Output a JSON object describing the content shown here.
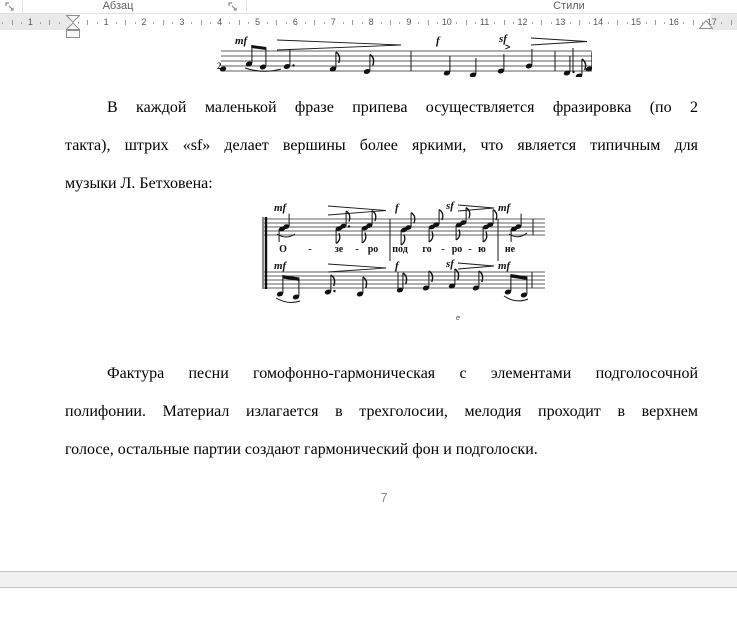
{
  "ui": {
    "ribbon": {
      "group_labels": [
        "Абзац",
        "Стили"
      ]
    },
    "ruler": {
      "numbers": [
        "1",
        "2",
        "3",
        "4",
        "5",
        "6",
        "7",
        "8",
        "9",
        "10",
        "11",
        "12",
        "13",
        "14",
        "15",
        "16",
        "17"
      ],
      "left_margin_number": "1"
    },
    "page_number": "7"
  },
  "document": {
    "paragraph1_lines": [
      "В каждой маленькой фразе припева осуществляется фразировка (по 2",
      "такта), штрих «sf» делает вершины более яркими, что является типичным для",
      "музыки Л. Бетховена:"
    ],
    "paragraph2_lines": [
      "Фактура песни гомофонно-гармоническая с элементами подголосочной",
      "полифонии. Материал излагается в трехголосии, мелодия проходит в верхнем",
      "голосе, остальные партии создают гармонический фон и подголоски."
    ]
  },
  "music_top": {
    "dynamics": [
      "mf",
      "f",
      "sf",
      ">"
    ],
    "time_signature_fragment": "2"
  },
  "music_chorus": {
    "dynamics_upper": [
      "mf",
      "f",
      "sf",
      "mf"
    ],
    "dynamics_lower": [
      "mf",
      "f",
      "sf",
      "mf"
    ],
    "lyrics": [
      "О",
      "-",
      "зе",
      "-",
      "ро",
      "под",
      "го",
      "-",
      "ро",
      "-",
      "ю",
      "не"
    ],
    "small_mark": "e"
  },
  "colors": {
    "page_background": "#ffffff",
    "chrome_border": "#e1e1e1",
    "ruler_margin": "#e9e9e9",
    "page_gap_fill": "#f1f1f1",
    "group_label_text": "#5f5f5f",
    "body_text": "#000000",
    "page_number_text": "#8a8a8a"
  }
}
